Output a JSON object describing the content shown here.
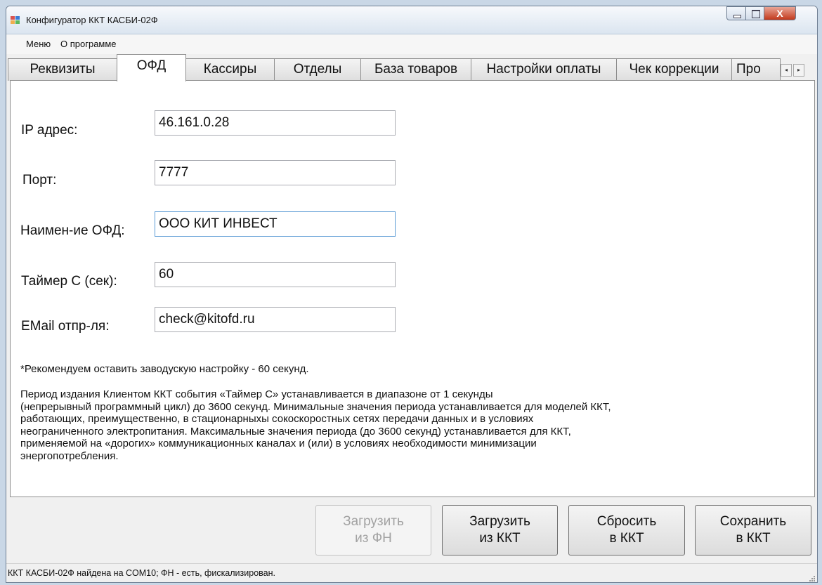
{
  "window": {
    "title": "Конфигуратор ККТ КАСБИ-02Ф",
    "close_glyph": "X"
  },
  "menu": {
    "items": [
      "Меню",
      "О программе"
    ]
  },
  "tabs": [
    {
      "label": "Реквизиты",
      "active": false
    },
    {
      "label": "ОФД",
      "active": true
    },
    {
      "label": "Кассиры",
      "active": false
    },
    {
      "label": "Отделы",
      "active": false
    },
    {
      "label": "База товаров",
      "active": false
    },
    {
      "label": "Настройки оплаты",
      "active": false
    },
    {
      "label": "Чек коррекции",
      "active": false
    },
    {
      "label": "Про",
      "active": false
    }
  ],
  "tab_scroll": {
    "left": "◂",
    "right": "▸"
  },
  "form": {
    "ip": {
      "label": "IP адрес:",
      "value": "46.161.0.28"
    },
    "port": {
      "label": "Порт:",
      "value": "7777"
    },
    "ofd_name": {
      "label": "Наимен-ие ОФД:",
      "value": "ООО КИТ ИНВЕСТ"
    },
    "timer": {
      "label": "Таймер С (сек):",
      "value": "60"
    },
    "email": {
      "label": "EMail отпр-ля:",
      "value": "check@kitofd.ru"
    }
  },
  "note": "*Рекомендуем оставить заводускую настройку - 60 секунд.",
  "description": [
    "Период издания Клиентом ККТ события «Таймер С» устанавливается в диапазоне от 1 секунды",
    " (непрерывный программный цикл) до 3600 секунд. Минимальные значения периода устанавливается для моделей ККТ,",
    "работающих, преимущественно, в стационарныхы сокоскоростных сетях передачи данных и в условиях",
    "неограниченного электропитания. Максимальные значения периода (до 3600 секунд) устанавливается для ККТ,",
    "применяемой на «дорогих» коммуникационных каналах и (или) в условиях необходимости минимизации",
    "энергопотребления."
  ],
  "buttons": {
    "load_fn": {
      "line1": "Загрузить",
      "line2": "из ФН",
      "enabled": false
    },
    "load_kkt": {
      "line1": "Загрузить",
      "line2": "из ККТ",
      "enabled": true
    },
    "reset_kkt": {
      "line1": "Сбросить",
      "line2": "в ККТ",
      "enabled": true
    },
    "save_kkt": {
      "line1": "Сохранить",
      "line2": "в ККТ",
      "enabled": true
    }
  },
  "status": "ККТ КАСБИ-02Ф найдена на COM10; ФН - есть, фискализирован.",
  "colors": {
    "close_button": "#c2391c",
    "focus_border": "#5b9bd5",
    "disabled_text": "#a2a2a2"
  }
}
